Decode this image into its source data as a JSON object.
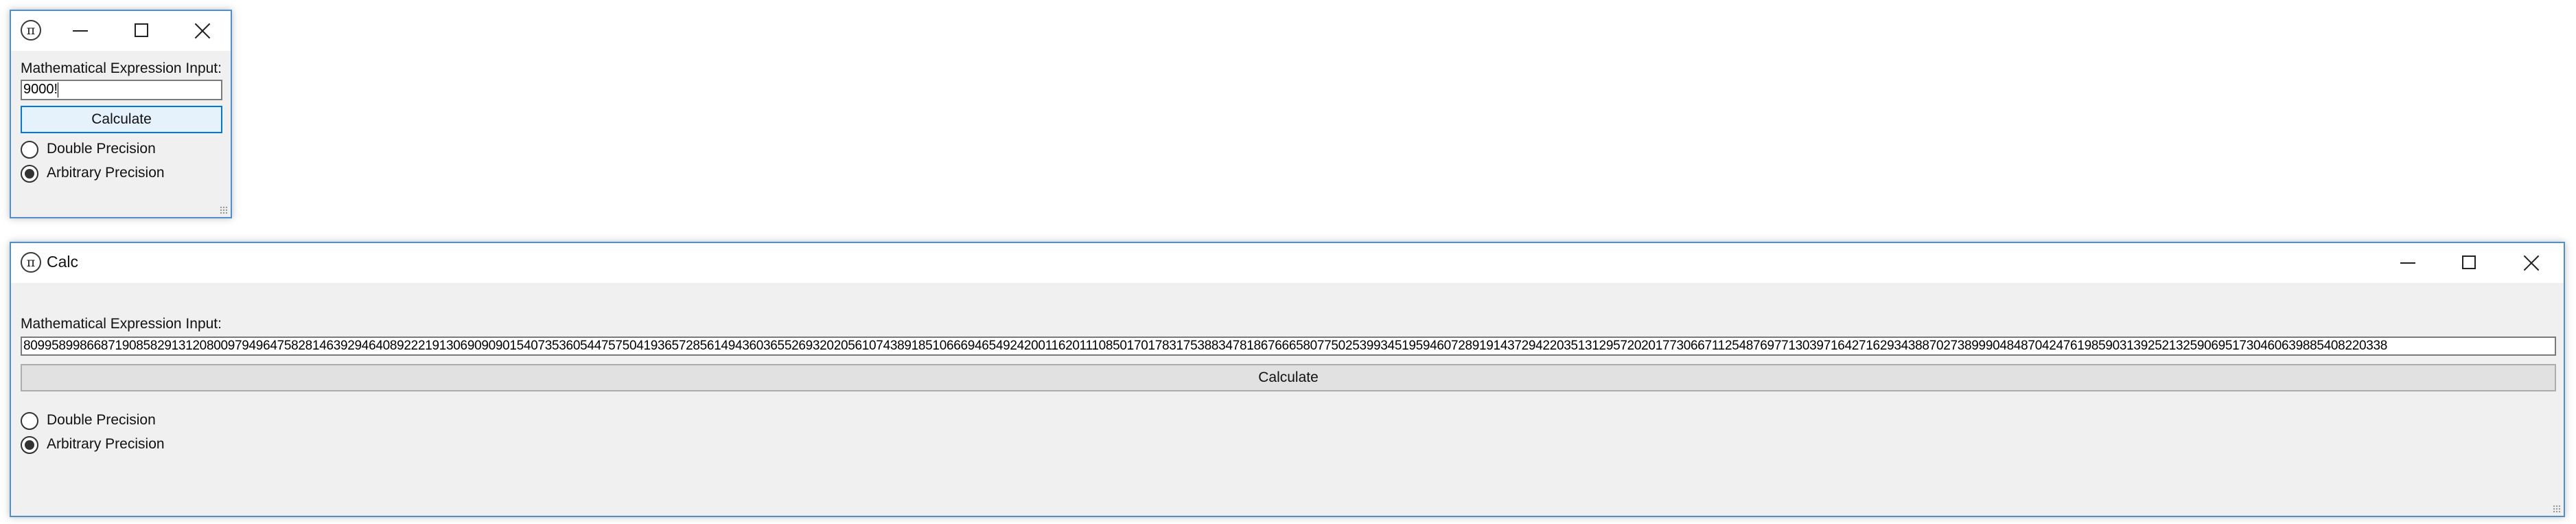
{
  "small_window": {
    "app_icon": "π",
    "title": "",
    "input_label": "Mathematical Expression Input:",
    "expression_value": "9000!",
    "calculate_label": "Calculate",
    "double_precision_label": "Double Precision",
    "arbitrary_precision_label": "Arbitrary Precision",
    "selected_mode": "Arbitrary Precision"
  },
  "large_window": {
    "app_icon": "π",
    "title": "Calc",
    "input_label": "Mathematical Expression Input:",
    "result_value": "809958998668719085829131208009794964758281463929464089222191306909090154073536054475750419365728561494360365526932020561074389185106669465492420011620111085017017831753883478186766658077502539934519594607289191437294220351312957202017730667112548769771303971642716293438870273899904848704247619859031392521325906951730460639885408220338",
    "calculate_label": "Calculate",
    "double_precision_label": "Double Precision",
    "arbitrary_precision_label": "Arbitrary Precision",
    "selected_mode": "Arbitrary Precision"
  },
  "icons": {
    "app": "pi-icon",
    "minimize": "minimize-icon",
    "maximize": "maximize-icon",
    "close": "close-icon"
  },
  "colors": {
    "window_border": "#4d8fd0",
    "focused_button_bg": "#e5f1fb",
    "focused_button_border": "#0078d7",
    "client_bg": "#f0f0f0"
  }
}
